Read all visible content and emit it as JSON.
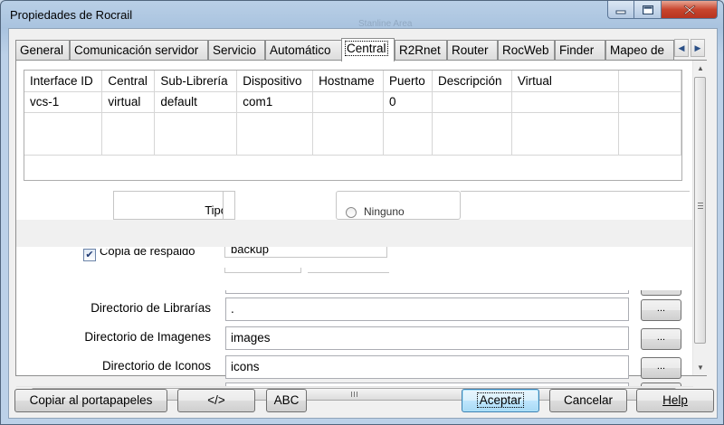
{
  "window": {
    "title": "Propiedades de Rocrail",
    "background_title": "Stanline Area"
  },
  "tabs": [
    {
      "label": "General"
    },
    {
      "label": "Comunicación servidor"
    },
    {
      "label": "Servicio"
    },
    {
      "label": "Automático"
    },
    {
      "label": "Central",
      "active": true
    },
    {
      "label": "R2Rnet"
    },
    {
      "label": "Router"
    },
    {
      "label": "RocWeb"
    },
    {
      "label": "Finder"
    },
    {
      "label": "Mapeo de"
    }
  ],
  "grid": {
    "headers": [
      "Interface ID",
      "Central",
      "Sub-Librería",
      "Dispositivo",
      "Hostname",
      "Puerto",
      "Descripción",
      "Virtual",
      ""
    ],
    "rows": [
      [
        "vcs-1",
        "virtual",
        "default",
        "com1",
        "",
        "0",
        "",
        "",
        ""
      ]
    ]
  },
  "form": {
    "tipo_label": "Tipo",
    "radio_label": "Ninguno",
    "backup_label": "Copia de respaldo",
    "backup_value": "backup",
    "backup_checked": true,
    "fields": [
      {
        "label": "Directorio de Librarías",
        "value": ".",
        "button": "..."
      },
      {
        "label": "Directorio de Imagenes",
        "value": "images",
        "button": "..."
      },
      {
        "label": "Directorio de Iconos",
        "value": "icons",
        "button": "..."
      }
    ]
  },
  "buttons": {
    "copy": "Copiar al portapapeles",
    "xml": "</>",
    "abc": "ABC",
    "ok": "Aceptar",
    "cancel": "Cancelar",
    "help": "Help"
  },
  "icons": {
    "minimize": "minimize-icon",
    "maximize": "maximize-icon",
    "close": "close-icon",
    "tab_left": "arrow-left-icon",
    "tab_right": "arrow-right-icon"
  }
}
